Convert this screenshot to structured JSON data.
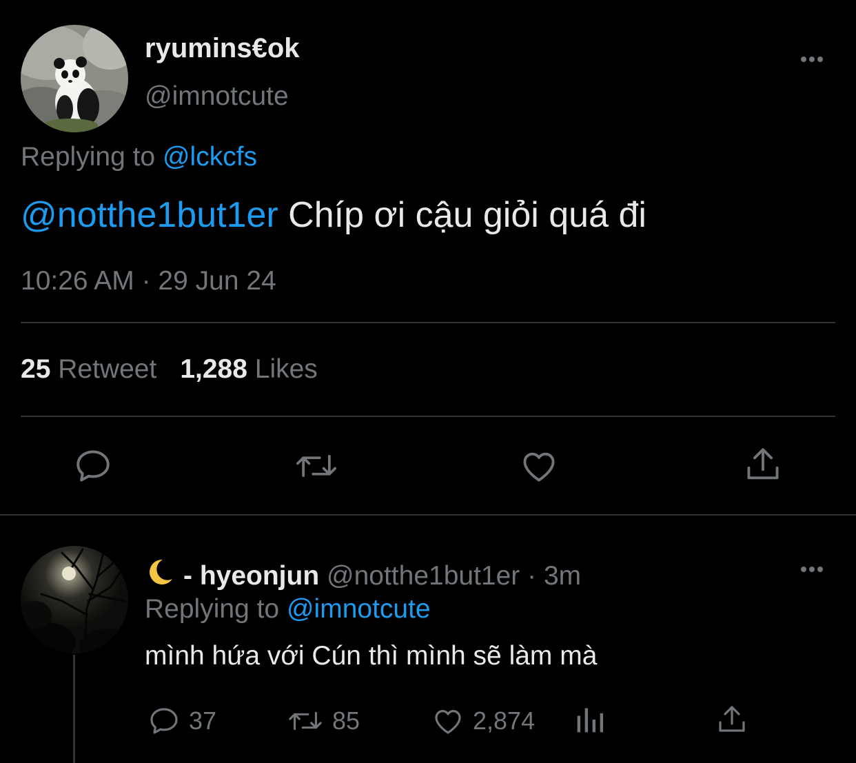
{
  "main_tweet": {
    "display_name": "ryumins€ok",
    "handle": "@imnotcute",
    "replying_prefix": "Replying to ",
    "replying_to": "@lckcfs",
    "mention": "@notthe1but1er",
    "text": " Chíp ơi cậu giỏi quá đi",
    "timestamp": "10:26 AM · 29 Jun 24",
    "retweet_count": "25",
    "retweet_label": "Retweet",
    "likes_count": "1,288",
    "likes_label": "Likes"
  },
  "reply_tweet": {
    "emoji": "🌙",
    "display_name": "- hyeonjun",
    "handle": "@notthe1but1er",
    "separator": " · ",
    "time_ago": "3m",
    "replying_prefix": "Replying to ",
    "replying_to": "@imnotcute",
    "text": "mình hứa với Cún thì mình sẽ làm mà",
    "reply_count": "37",
    "retweet_count": "85",
    "like_count": "2,874"
  },
  "icons": {
    "more": "more-icon",
    "reply": "reply-icon",
    "retweet": "retweet-icon",
    "like": "heart-icon",
    "share": "share-icon",
    "analytics": "analytics-icon"
  },
  "colors": {
    "background": "#000000",
    "text": "#e7e9ea",
    "secondary": "#71767b",
    "link": "#1d9bf0",
    "divider": "#2f3336"
  }
}
